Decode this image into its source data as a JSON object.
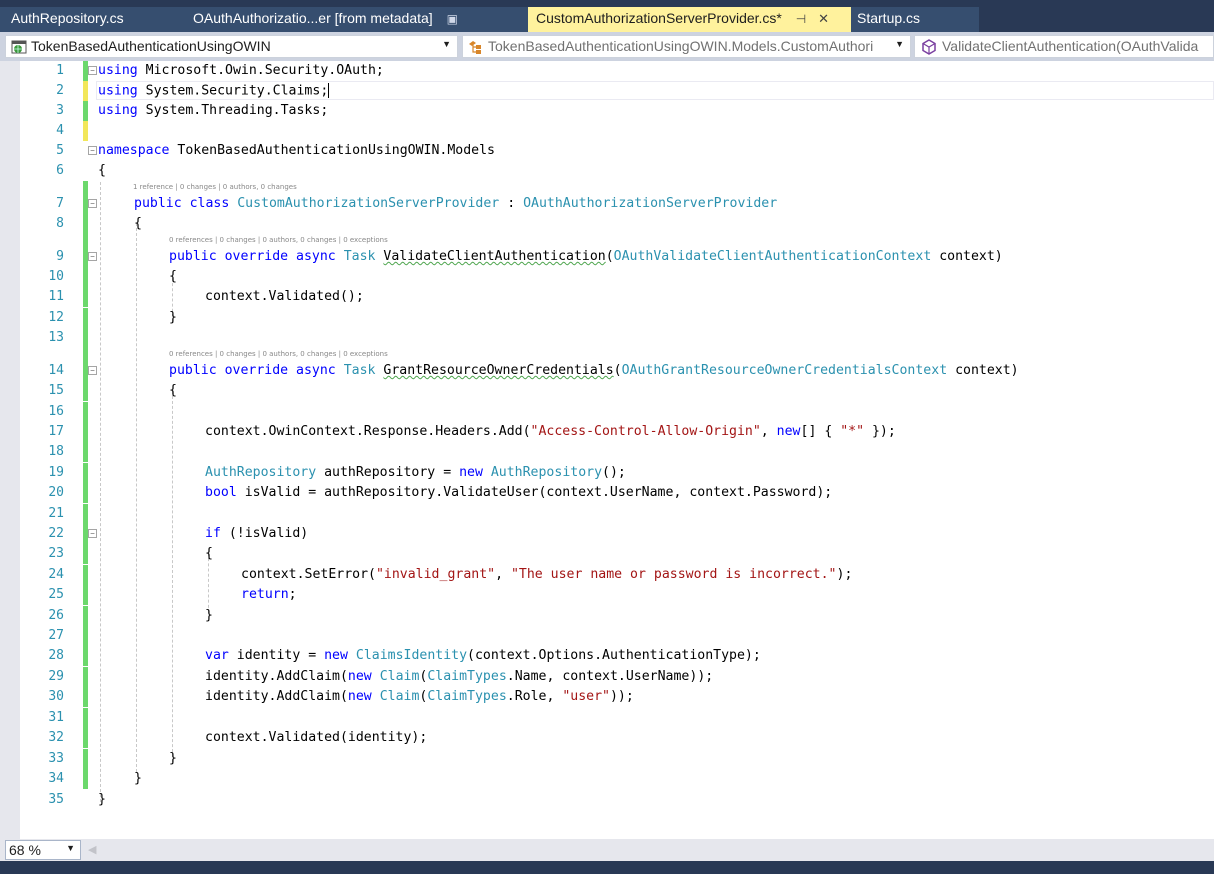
{
  "tabs": [
    {
      "label": "AuthRepository.cs",
      "active": false,
      "icon": ""
    },
    {
      "label": "OAuthAuthorizatio...er [from metadata]",
      "active": false,
      "icon": "lock-icon"
    },
    {
      "label": "CustomAuthorizationServerProvider.cs*",
      "active": true,
      "icon": "pin-icon"
    },
    {
      "label": "Startup.cs",
      "active": false,
      "icon": ""
    }
  ],
  "tab_icons": {
    "lock": "▣",
    "pin": "⊣",
    "close": "✕"
  },
  "navbar": {
    "project": "TokenBasedAuthenticationUsingOWIN",
    "type": "TokenBasedAuthenticationUsingOWIN.Models.CustomAuthori",
    "member": "ValidateClientAuthentication(OAuthValida",
    "dropdown_arrow": "▼"
  },
  "codelens": {
    "class": "1 reference | 0 changes | 0 authors, 0 changes",
    "method1": "0 references | 0 changes | 0 authors, 0 changes | 0 exceptions",
    "method2": "0 references | 0 changes | 0 authors, 0 changes | 0 exceptions"
  },
  "line_numbers": [
    "1",
    "2",
    "3",
    "4",
    "5",
    "6",
    "7",
    "8",
    "9",
    "10",
    "11",
    "12",
    "13",
    "14",
    "15",
    "16",
    "17",
    "18",
    "19",
    "20",
    "21",
    "22",
    "23",
    "24",
    "25",
    "26",
    "27",
    "28",
    "29",
    "30",
    "31",
    "32",
    "33",
    "34",
    "35"
  ],
  "code": {
    "l1_kw": "using",
    "l1": " Microsoft.Owin.Security.OAuth;",
    "l2_kw": "using",
    "l2": " System.Security.Claims;",
    "l3_kw": "using",
    "l3": " System.Threading.Tasks;",
    "l5_kw": "namespace",
    "l5": " TokenBasedAuthenticationUsingOWIN.Models",
    "open": "{",
    "close": "}",
    "l7_kw": "public class",
    "l7_name": "CustomAuthorizationServerProvider",
    "l7_colon": " : ",
    "l7_base": "OAuthAuthorizationServerProvider",
    "mod": "public override async",
    "task": "Task",
    "l9_name": "ValidateClientAuthentication",
    "l9_ptype": "OAuthValidateClientAuthenticationContext",
    "param": " context)",
    "l11": "context.Validated();",
    "l14_name": "GrantResourceOwnerCredentials",
    "l14_ptype": "OAuthGrantResourceOwnerCredentialsContext",
    "l17_a": "context.OwinContext.Response.Headers.Add(",
    "l17_s1": "\"Access-Control-Allow-Origin\"",
    "l17_b": ", ",
    "l17_new": "new",
    "l17_c": "[] { ",
    "l17_s2": "\"*\"",
    "l17_d": " });",
    "l19_t": "AuthRepository",
    "l19_a": " authRepository = ",
    "l19_new": "new",
    "l19_t2": "AuthRepository",
    "l19_b": "();",
    "l20_kw": "bool",
    "l20": " isValid = authRepository.ValidateUser(context.UserName, context.Password);",
    "l22_kw": "if",
    "l22": " (!isValid)",
    "l24_a": "context.SetError(",
    "l24_s1": "\"invalid_grant\"",
    "l24_b": ", ",
    "l24_s2": "\"The user name or password is incorrect.\"",
    "l24_c": ");",
    "l25_kw": "return",
    "l25": ";",
    "l28_kw": "var",
    "l28_a": " identity = ",
    "l28_new": "new",
    "l28_t": "ClaimsIdentity",
    "l28_b": "(context.Options.AuthenticationType);",
    "l29_a": "identity.AddClaim(",
    "l29_new": "new",
    "l29_t": "Claim",
    "l29_p": "(",
    "l29_t2": "ClaimTypes",
    "l29_b": ".Name, context.UserName));",
    "l30_b": ".Role, ",
    "l30_s": "\"user\"",
    "l30_c": "));",
    "l32": "context.Validated(identity);"
  },
  "zoom_level": "68 %",
  "scroll_left_icon": "◀"
}
